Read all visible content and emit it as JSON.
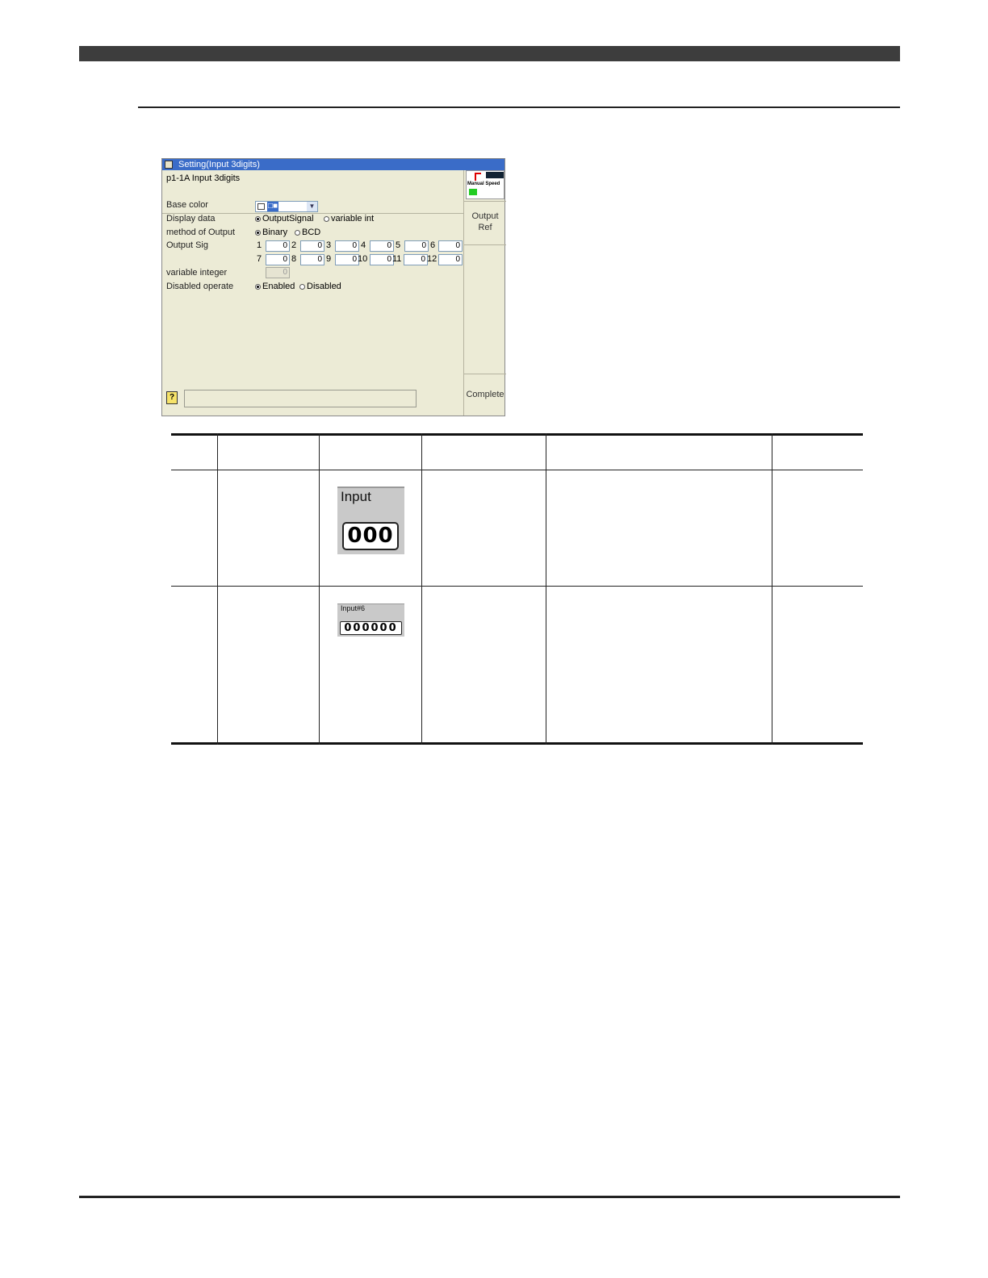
{
  "dialog": {
    "title": "Setting(Input 3digits)",
    "subtitle": "p1-1A  Input 3digits",
    "base_color": {
      "label": "Base color",
      "value": "□■"
    },
    "display_data": {
      "label": "Display data",
      "opt1": "OutputSignal",
      "opt2": "variable int",
      "selected": "OutputSignal"
    },
    "method": {
      "label": "method of Output",
      "opt1": "Binary",
      "opt2": "BCD",
      "selected": "Binary"
    },
    "output_sig": {
      "label": "Output Sig",
      "signals": [
        {
          "n": "1",
          "v": "0"
        },
        {
          "n": "2",
          "v": "0"
        },
        {
          "n": "3",
          "v": "0"
        },
        {
          "n": "4",
          "v": "0"
        },
        {
          "n": "5",
          "v": "0"
        },
        {
          "n": "6",
          "v": "0"
        },
        {
          "n": "7",
          "v": "0"
        },
        {
          "n": "8",
          "v": "0"
        },
        {
          "n": "9",
          "v": "0"
        },
        {
          "n": "10",
          "v": "0"
        },
        {
          "n": "11",
          "v": "0"
        },
        {
          "n": "12",
          "v": "0"
        }
      ]
    },
    "variable_integer": {
      "label": "variable integer",
      "value": "0"
    },
    "disabled_operate": {
      "label": "Disabled operate",
      "opt1": "Enabled",
      "opt2": "Disabled",
      "selected": "Enabled"
    },
    "side": {
      "status_text": "Manual Speed",
      "output_ref_1": "Output",
      "output_ref_2": "Ref",
      "complete": "Complete"
    },
    "help_icon": "?"
  },
  "samples": {
    "input3": {
      "title": "Input",
      "digits": "000"
    },
    "input6": {
      "title": "Input#6",
      "digits": "000000"
    }
  }
}
